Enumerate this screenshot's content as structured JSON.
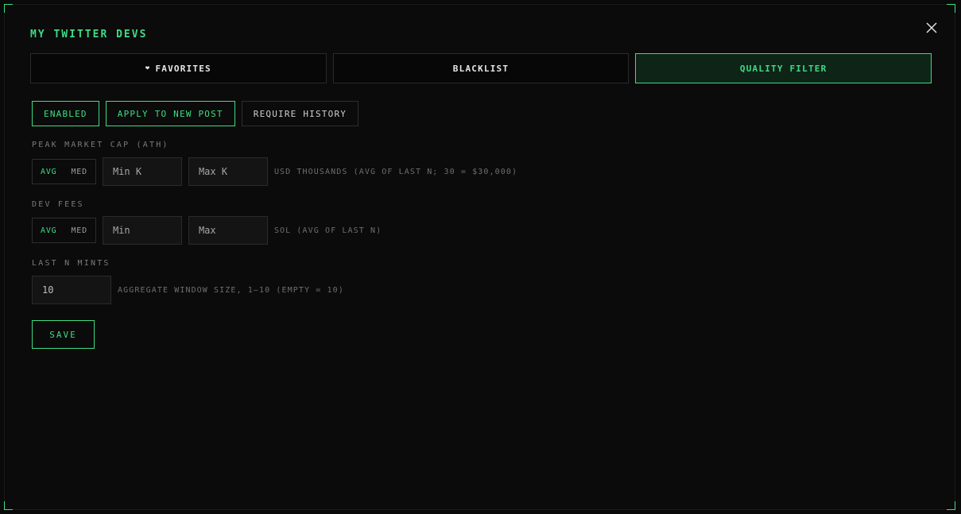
{
  "modal": {
    "title": "MY TWITTER DEVS"
  },
  "tabs": [
    {
      "label": "FAVORITES",
      "icon": "heart-icon",
      "active": false
    },
    {
      "label": "BLACKLIST",
      "active": false
    },
    {
      "label": "QUALITY FILTER",
      "active": true
    }
  ],
  "toggles": [
    {
      "label": "ENABLED",
      "on": true
    },
    {
      "label": "APPLY TO NEW POST",
      "on": true
    },
    {
      "label": "REQUIRE HISTORY",
      "on": false
    }
  ],
  "peak_market_cap": {
    "label": "PEAK MARKET CAP (ATH)",
    "avg_label": "AVG",
    "med_label": "MED",
    "selected": "AVG",
    "min_placeholder": "Min K",
    "max_placeholder": "Max K",
    "hint": "USD THOUSANDS (AVG OF LAST N; 30 = $30,000)"
  },
  "dev_fees": {
    "label": "DEV FEES",
    "avg_label": "AVG",
    "med_label": "MED",
    "selected": "AVG",
    "min_placeholder": "Min",
    "max_placeholder": "Max",
    "hint": "SOL (AVG OF LAST N)"
  },
  "last_n_mints": {
    "label": "LAST N MINTS",
    "value": "10",
    "hint": "AGGREGATE WINDOW SIZE, 1–10 (EMPTY = 10)"
  },
  "save_label": "SAVE",
  "colors": {
    "accent": "#3ddc84",
    "background": "#0b0b0b"
  }
}
